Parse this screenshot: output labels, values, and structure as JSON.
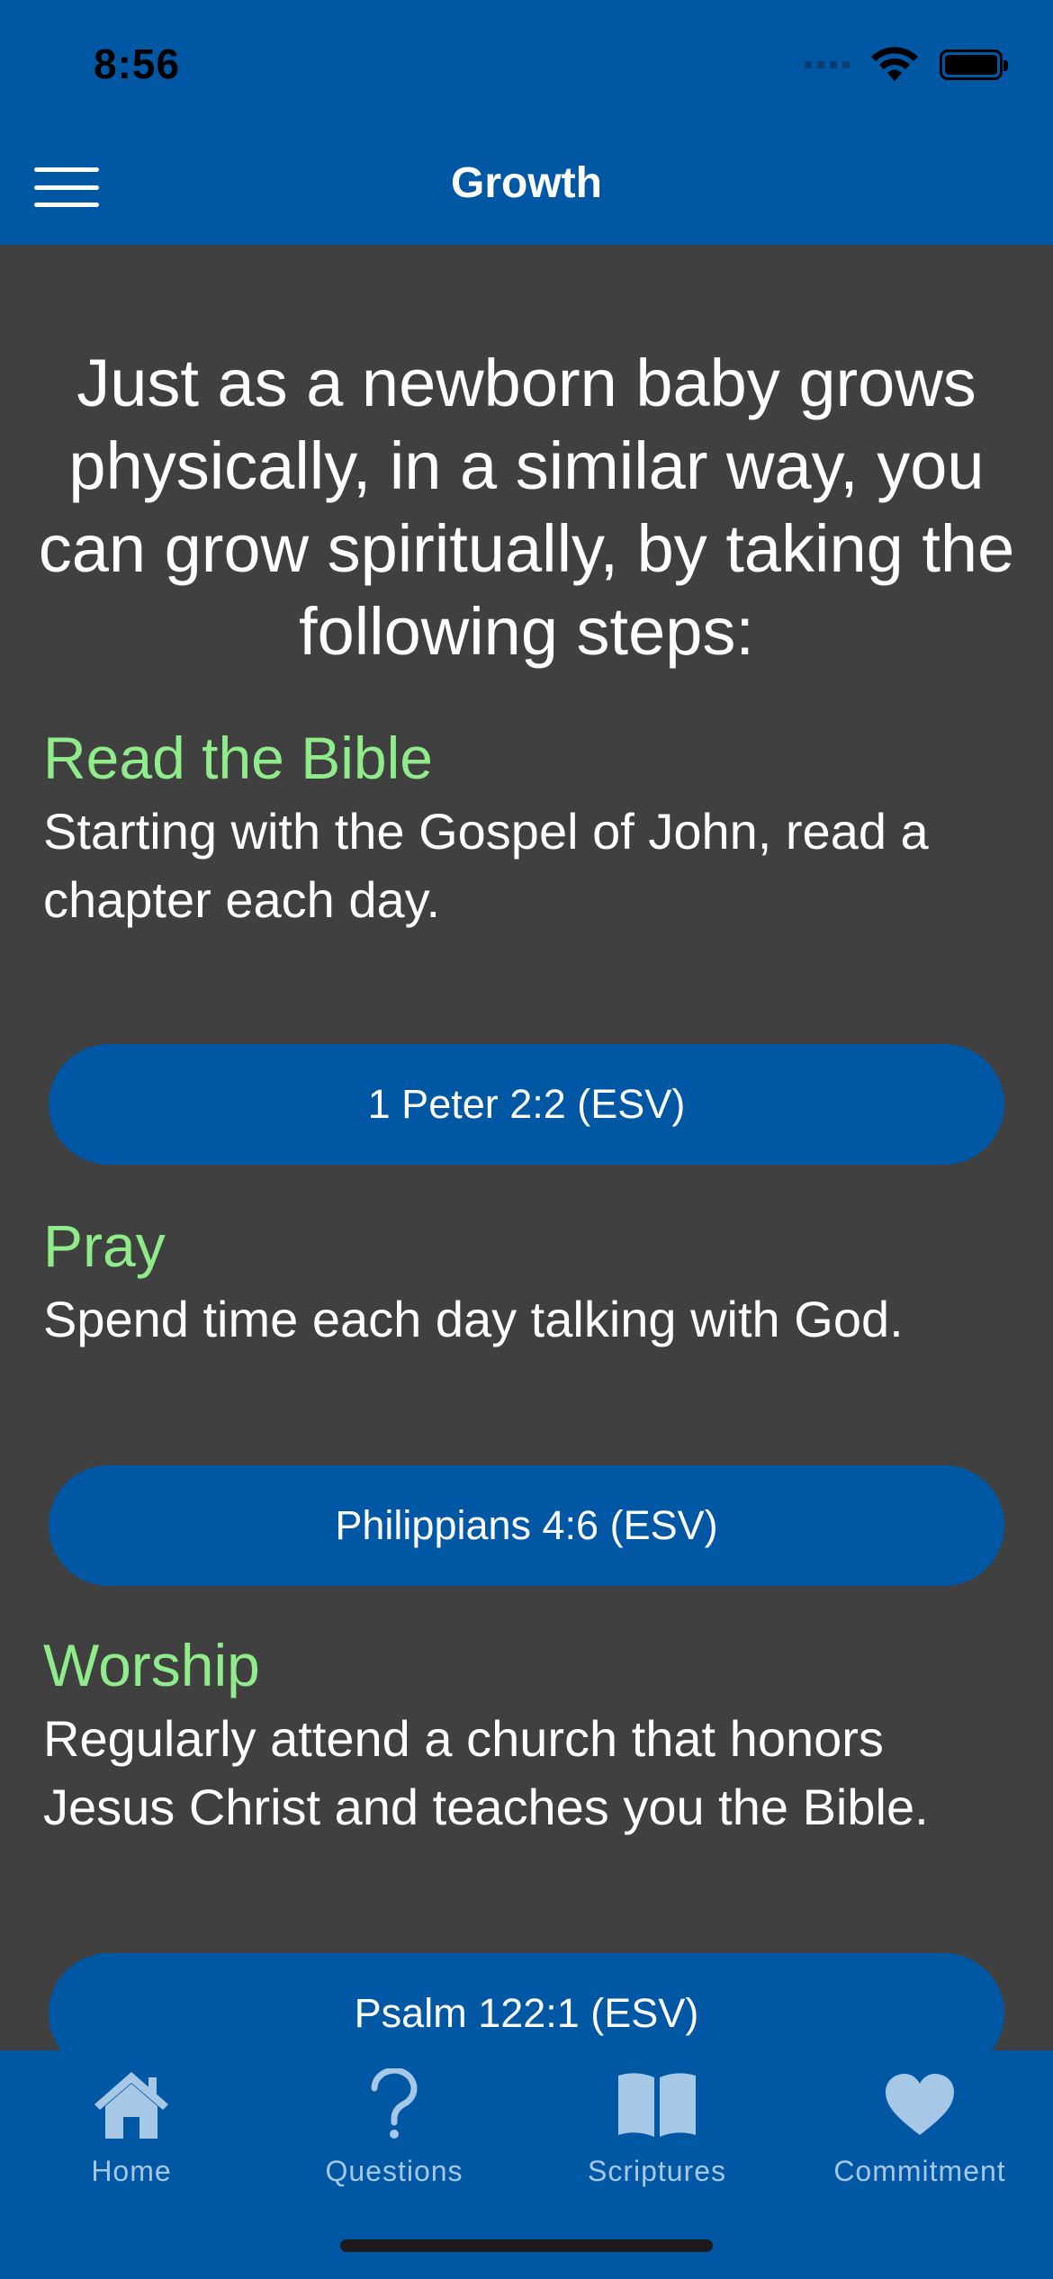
{
  "status_bar": {
    "time": "8:56"
  },
  "nav": {
    "title": "Growth",
    "menu_icon": "hamburger-menu-icon"
  },
  "intro": "Just as a newborn baby grows physically, in a similar way, you can grow spiritually, by taking the following steps:",
  "sections": [
    {
      "heading": "Read the Bible",
      "body": "Starting with the Gospel of John, read a chapter each day.",
      "verse_button": "1 Peter 2:2 (ESV)"
    },
    {
      "heading": "Pray",
      "body": "Spend time each day talking with God.",
      "verse_button": "Philippians 4:6 (ESV)"
    },
    {
      "heading": "Worship",
      "body": "Regularly attend a church that honors Jesus Christ and teaches you the Bible.",
      "verse_button": "Psalm 122:1 (ESV)"
    }
  ],
  "tabs": [
    {
      "label": "Home",
      "icon": "home-icon"
    },
    {
      "label": "Questions",
      "icon": "question-mark-icon"
    },
    {
      "label": "Scriptures",
      "icon": "open-book-icon"
    },
    {
      "label": "Commitment",
      "icon": "heart-icon"
    }
  ],
  "colors": {
    "accent_blue": "#0057a3",
    "background": "#404040",
    "heading_green": "#90ec8a",
    "tab_icon": "#a6c8e6"
  }
}
